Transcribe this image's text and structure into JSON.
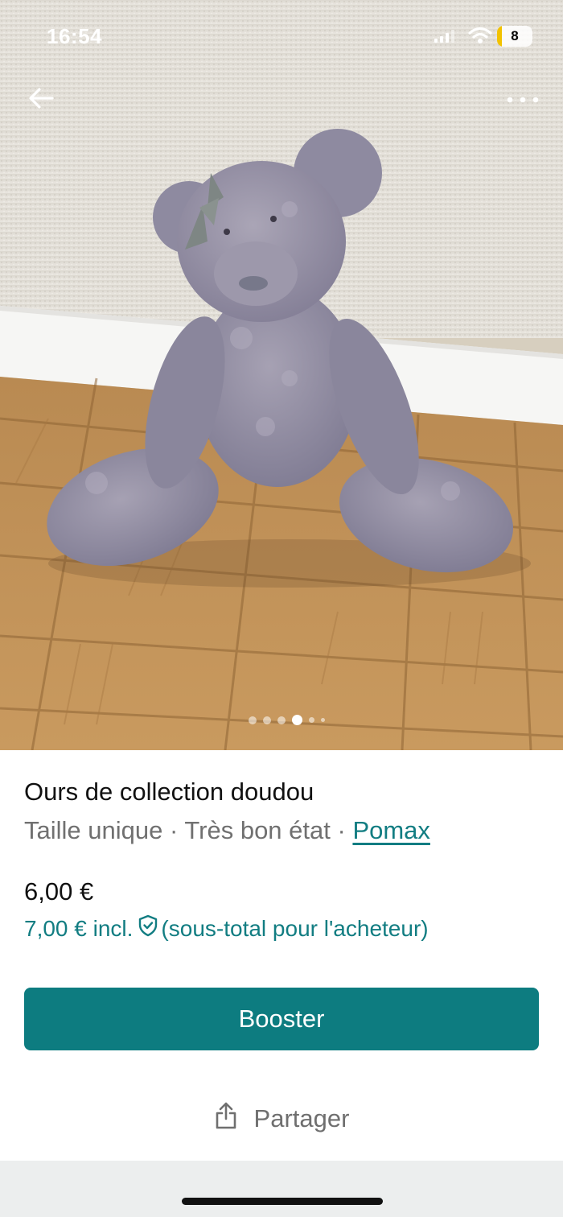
{
  "status_bar": {
    "time": "16:54",
    "battery_level": "8",
    "icons": [
      "signal-icon",
      "wifi-icon",
      "battery-icon"
    ]
  },
  "nav": {
    "back_icon": "arrow-left-icon",
    "more_icon": "more-horizontal-icon"
  },
  "gallery": {
    "image_count": 6,
    "active_index": 3
  },
  "item": {
    "title": "Ours de collection doudou",
    "size": "Taille unique",
    "separator": " · ",
    "condition": "Très bon état",
    "seller": "Pomax",
    "price": "6,00 €",
    "buyer_price": "7,00 € incl.",
    "buyer_price_note": "(sous-total pour l'acheteur)",
    "buyer_icon": "shield-check-icon"
  },
  "actions": {
    "boost_label": "Booster",
    "share_label": "Partager",
    "share_icon": "share-icon"
  },
  "colors": {
    "accent": "#0d7c80",
    "link": "#127d82",
    "text": "#111111",
    "muted": "#707070",
    "bottom_strip": "#eceeee"
  }
}
